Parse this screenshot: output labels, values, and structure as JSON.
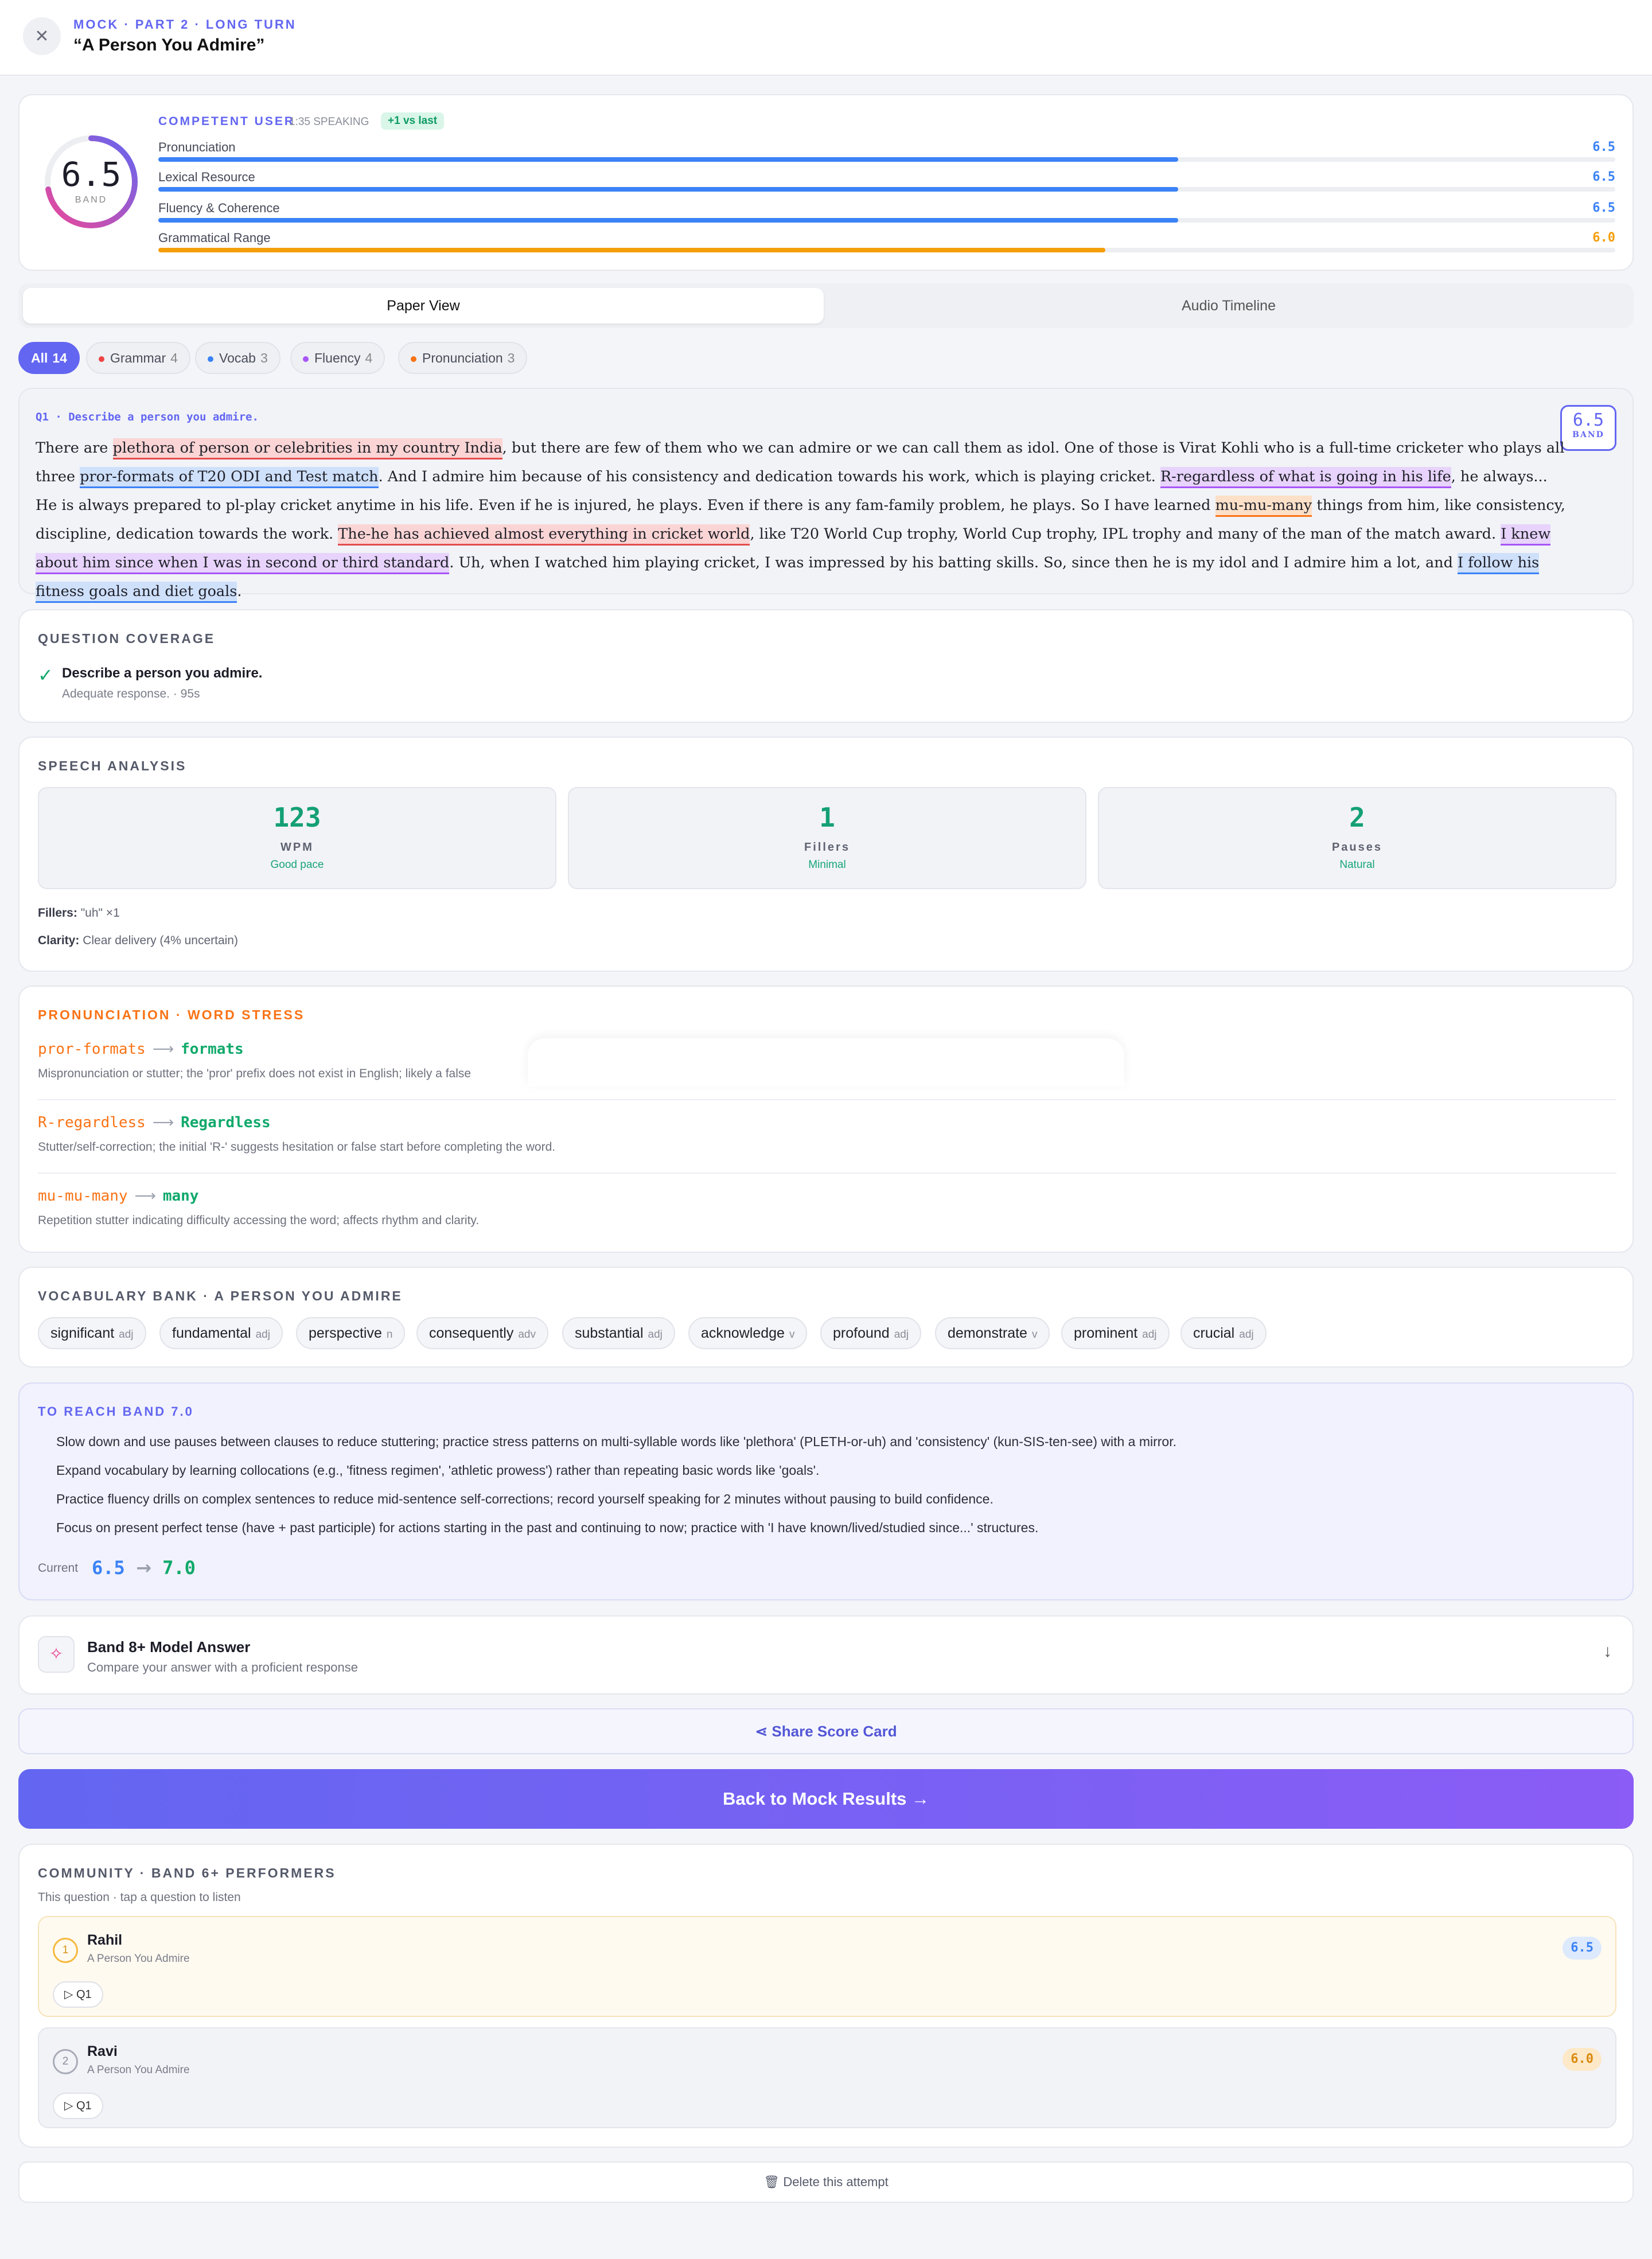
{
  "header": {
    "subtitle": "MOCK · PART 2 · LONG TURN",
    "title": "“A Person You Admire”",
    "close_icon": "close-icon"
  },
  "score": {
    "band": "6.5",
    "band_label": "BAND",
    "level": "COMPETENT USER",
    "speaking_time": "1:35 SPEAKING",
    "delta": "+1 vs last",
    "criteria": [
      {
        "name": "Pronunciation",
        "value": "6.5",
        "fraction": 0.7,
        "color": "#3b82f6"
      },
      {
        "name": "Lexical Resource",
        "value": "6.5",
        "fraction": 0.7,
        "color": "#3b82f6"
      },
      {
        "name": "Fluency & Coherence",
        "value": "6.5",
        "fraction": 0.7,
        "color": "#3b82f6"
      },
      {
        "name": "Grammatical Range",
        "value": "6.0",
        "fraction": 0.65,
        "color": "#f59e0b"
      }
    ]
  },
  "tabs": [
    "Paper View",
    "Audio Timeline"
  ],
  "filters": [
    {
      "label": "All",
      "count": "14",
      "color": ""
    },
    {
      "label": "Grammar",
      "count": "4",
      "color": "#ef4444"
    },
    {
      "label": "Vocab",
      "count": "3",
      "color": "#3b82f6"
    },
    {
      "label": "Fluency",
      "count": "4",
      "color": "#a855f7"
    },
    {
      "label": "Pronunciation",
      "count": "3",
      "color": "#f97316"
    }
  ],
  "paper": {
    "question": "Q1 · Describe a person you admire.",
    "band": "6.5",
    "band_label": "BAND",
    "segments": [
      {
        "t": "There are ",
        "c": ""
      },
      {
        "t": "plethora of person or celebrities in my country India",
        "c": "grammar"
      },
      {
        "t": ", but there are few of them who we can admire or we can call them as idol. One of those is Virat Kohli who is a full-time cricketer who plays all three ",
        "c": ""
      },
      {
        "t": "pror-formats of T20 ODI and Test match",
        "c": "vocab"
      },
      {
        "t": ". And I admire him because of his consistency and dedication towards his work, which is playing cricket. ",
        "c": ""
      },
      {
        "t": "R-regardless of what is going in his life",
        "c": "fluency"
      },
      {
        "t": ", he always... He is always prepared to pl-play cricket anytime in his life. Even if he is injured, he plays. Even if there is any fam-family problem, he plays. So I have learned ",
        "c": ""
      },
      {
        "t": "mu-mu-many",
        "c": "pron"
      },
      {
        "t": " things from him, like consistency, discipline, dedication towards the work. ",
        "c": ""
      },
      {
        "t": "The-he has achieved almost everything in cricket world",
        "c": "grammar"
      },
      {
        "t": ", like T20 World Cup trophy, World Cup trophy, IPL trophy and many of the man of the match award. ",
        "c": ""
      },
      {
        "t": "I knew about him since when I was in second or third standard",
        "c": "fluency"
      },
      {
        "t": ". Uh, when I watched him playing cricket, I was impressed by his batting skills. So, since then he is my idol and I admire him a lot, and ",
        "c": ""
      },
      {
        "t": "I follow his fitness goals and diet goals",
        "c": "vocab"
      },
      {
        "t": ".",
        "c": ""
      }
    ]
  },
  "coverage": {
    "title": "QUESTION COVERAGE",
    "question": "Describe a person you admire.",
    "summary": "Adequate response. · 95s"
  },
  "speech": {
    "title": "SPEECH ANALYSIS",
    "stats": [
      {
        "value": "123",
        "label": "WPM",
        "desc": "Good pace"
      },
      {
        "value": "1",
        "label": "Fillers",
        "desc": "Minimal"
      },
      {
        "value": "2",
        "label": "Pauses",
        "desc": "Natural"
      }
    ],
    "fillers_label": "Fillers:",
    "fillers_value": "\"uh\" ×1",
    "clarity_label": "Clarity:",
    "clarity_value": "Clear delivery (4% uncertain)"
  },
  "pronunciation": {
    "title": "PRONUNCIATION · WORD STRESS",
    "items": [
      {
        "wrong": "pror-formats",
        "right": "formats",
        "note": "Mispronunciation or stutter; the 'pror' prefix does not exist in English; likely a false"
      },
      {
        "wrong": "R-regardless",
        "right": "Regardless",
        "note": "Stutter/self-correction; the initial 'R-' suggests hesitation or false start before completing the word."
      },
      {
        "wrong": "mu-mu-many",
        "right": "many",
        "note": "Repetition stutter indicating difficulty accessing the word; affects rhythm and clarity."
      }
    ]
  },
  "vocab": {
    "title": "VOCABULARY BANK · A PERSON YOU ADMIRE",
    "words": [
      {
        "w": "significant",
        "p": "adj"
      },
      {
        "w": "fundamental",
        "p": "adj"
      },
      {
        "w": "perspective",
        "p": "n"
      },
      {
        "w": "consequently",
        "p": "adv"
      },
      {
        "w": "substantial",
        "p": "adj"
      },
      {
        "w": "acknowledge",
        "p": "v"
      },
      {
        "w": "profound",
        "p": "adj"
      },
      {
        "w": "demonstrate",
        "p": "v"
      },
      {
        "w": "prominent",
        "p": "adj"
      },
      {
        "w": "crucial",
        "p": "adj"
      }
    ]
  },
  "reach": {
    "title": "TO REACH BAND 7.0",
    "tips": [
      "Slow down and use pauses between clauses to reduce stuttering; practice stress patterns on multi-syllable words like 'plethora' (PLETH-or-uh) and 'consistency' (kun-SIS-ten-see) with a mirror.",
      "Expand vocabulary by learning collocations (e.g., 'fitness regimen', 'athletic prowess') rather than repeating basic words like 'goals'.",
      "Practice fluency drills on complex sentences to reduce mid-sentence self-corrections; record yourself speaking for 2 minutes without pausing to build confidence.",
      "Focus on present perfect tense (have + past participle) for actions starting in the past and continuing to now; practice with 'I have known/lived/studied since...' structures."
    ],
    "current_label": "Current",
    "current": "6.5",
    "target": "7.0"
  },
  "model": {
    "title": "Band 8+ Model Answer",
    "subtitle": "Compare your answer with a proficient response",
    "icon": "sparkles-icon"
  },
  "share_label": "Share Score Card",
  "back_label": "Back to Mock Results",
  "community": {
    "title": "COMMUNITY · BAND 6+ PERFORMERS",
    "subtitle": "This question · tap a question to listen",
    "performers": [
      {
        "rank": "1",
        "name": "Rahil",
        "topic": "A Person You Admire",
        "play": "Q1",
        "score": "6.5"
      },
      {
        "rank": "2",
        "name": "Ravi",
        "topic": "A Person You Admire",
        "play": "Q1",
        "score": "6.0"
      }
    ]
  },
  "delete_label": "Delete this attempt"
}
